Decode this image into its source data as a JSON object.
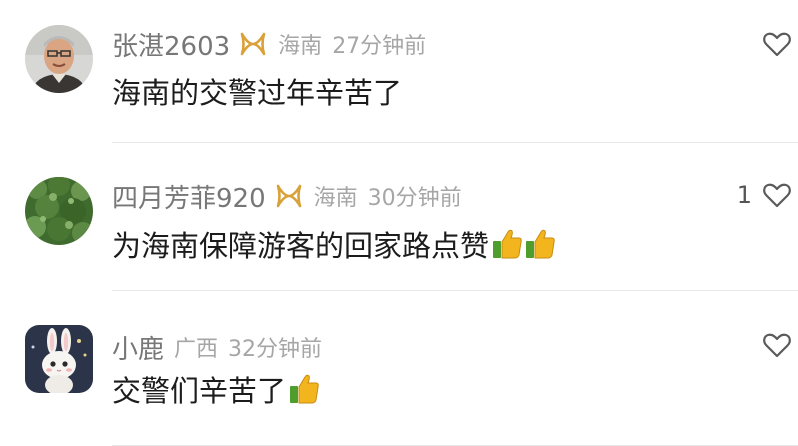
{
  "comments": [
    {
      "username": "张湛2603",
      "badge_icon": "golden-ribbon-badge-icon",
      "location": "海南",
      "time": "27分钟前",
      "text": "海南的交警过年辛苦了",
      "like_count": "",
      "avatar": "elderly-man-avatar"
    },
    {
      "username": "四月芳菲920",
      "badge_icon": "golden-ribbon-badge-icon",
      "location": "海南",
      "time": "30分钟前",
      "text": "为海南保障游客的回家路点赞",
      "emojis": [
        "thumbs-up-emoji",
        "thumbs-up-emoji"
      ],
      "like_count": "1",
      "avatar": "green-plants-avatar"
    },
    {
      "username": "小鹿",
      "location": "广西",
      "time": "32分钟前",
      "text": "交警们辛苦了",
      "emojis": [
        "thumbs-up-emoji"
      ],
      "like_count": "",
      "avatar": "white-bunny-avatar"
    }
  ],
  "colors": {
    "username": "#777777",
    "meta": "#a6a6a6",
    "text": "#1c1c1c",
    "badge_gold": "#d9a13a",
    "thumb_yellow": "#f2b51d",
    "thumb_green": "#4f9d2d",
    "divider": "#e8e8e8"
  }
}
